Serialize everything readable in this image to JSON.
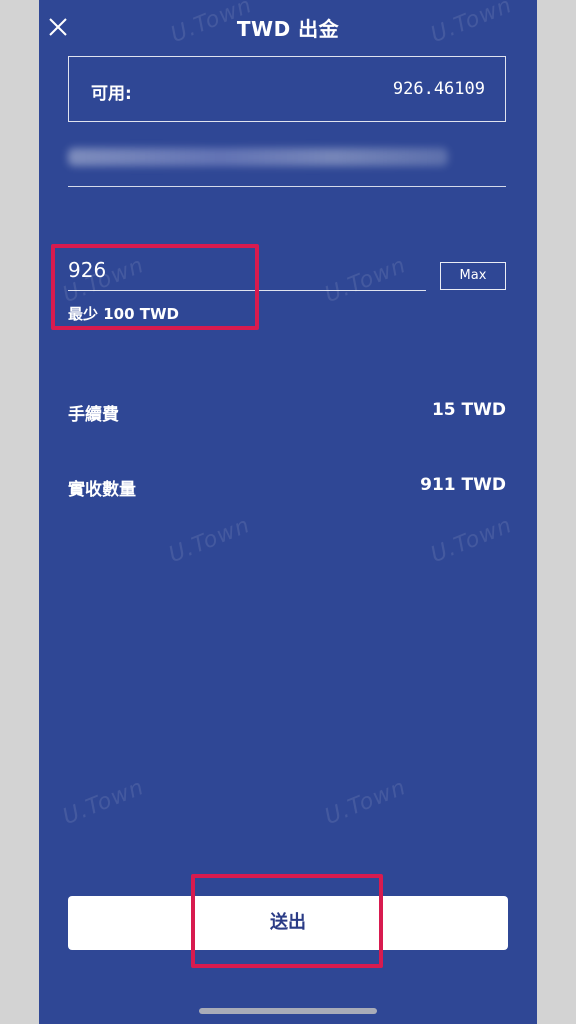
{
  "header": {
    "title": "TWD 出金",
    "close_icon": "close-icon"
  },
  "available": {
    "label": "可用:",
    "value": "926.46109"
  },
  "amount": {
    "value": "926",
    "min_note": "最少 100 TWD",
    "max_label": "Max"
  },
  "summary": {
    "fee_label": "手續費",
    "fee_value": "15 TWD",
    "receive_label": "實收數量",
    "receive_value": "911 TWD"
  },
  "submit": {
    "label": "送出"
  },
  "watermark": {
    "text": "U.Town"
  },
  "colors": {
    "background": "#2f4795",
    "highlight": "#d81b4f",
    "button_text": "#2a3b86"
  }
}
